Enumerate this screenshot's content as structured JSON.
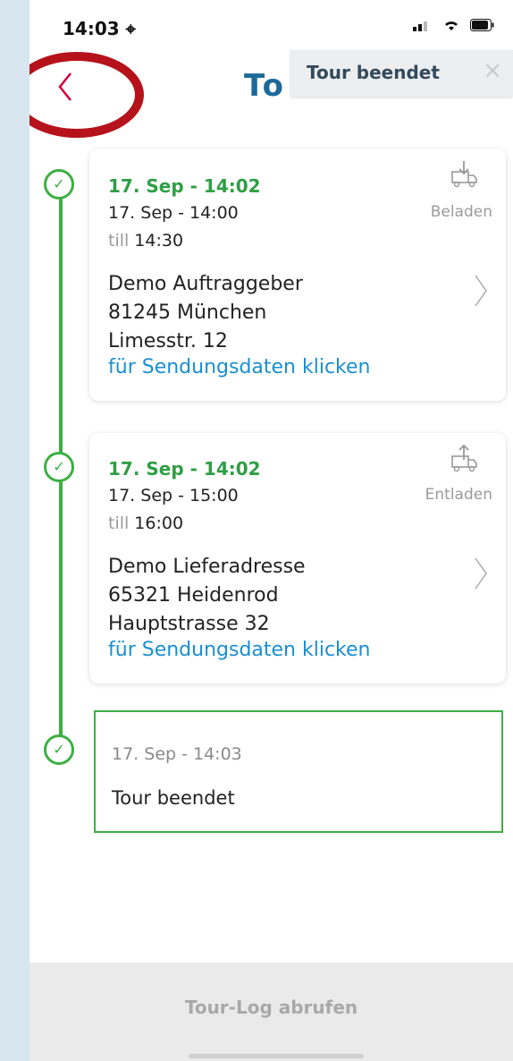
{
  "status": {
    "time": "14:03 ⌖"
  },
  "header": {
    "title": "To",
    "tooltip": "Tour beendet",
    "tooltip_close": "×"
  },
  "stops": [
    {
      "actual_time": "17. Sep - 14:02",
      "planned": "17. Sep - 14:00",
      "till_word": "till",
      "till_time": "14:30",
      "address": [
        "Demo Auftraggeber",
        "81245 München",
        "Limesstr. 12"
      ],
      "link": "für Sendungsdaten klicken",
      "action_label": "Beladen",
      "action_icon": "truck-load-icon"
    },
    {
      "actual_time": "17. Sep - 14:02",
      "planned": "17. Sep - 15:00",
      "till_word": "till",
      "till_time": "16:00",
      "address": [
        "Demo Lieferadresse",
        "65321 Heidenrod",
        "Hauptstrasse 32"
      ],
      "link": "für Sendungsdaten klicken",
      "action_label": "Entladen",
      "action_icon": "truck-unload-icon"
    }
  ],
  "end": {
    "time": "17. Sep - 14:03",
    "text": "Tour beendet"
  },
  "footer": {
    "button": "Tour-Log abrufen"
  },
  "colors": {
    "accent_green": "#3cb043",
    "link_blue": "#1a8fd0",
    "title_blue": "#1d6a9a",
    "back_red": "#d0003a"
  }
}
